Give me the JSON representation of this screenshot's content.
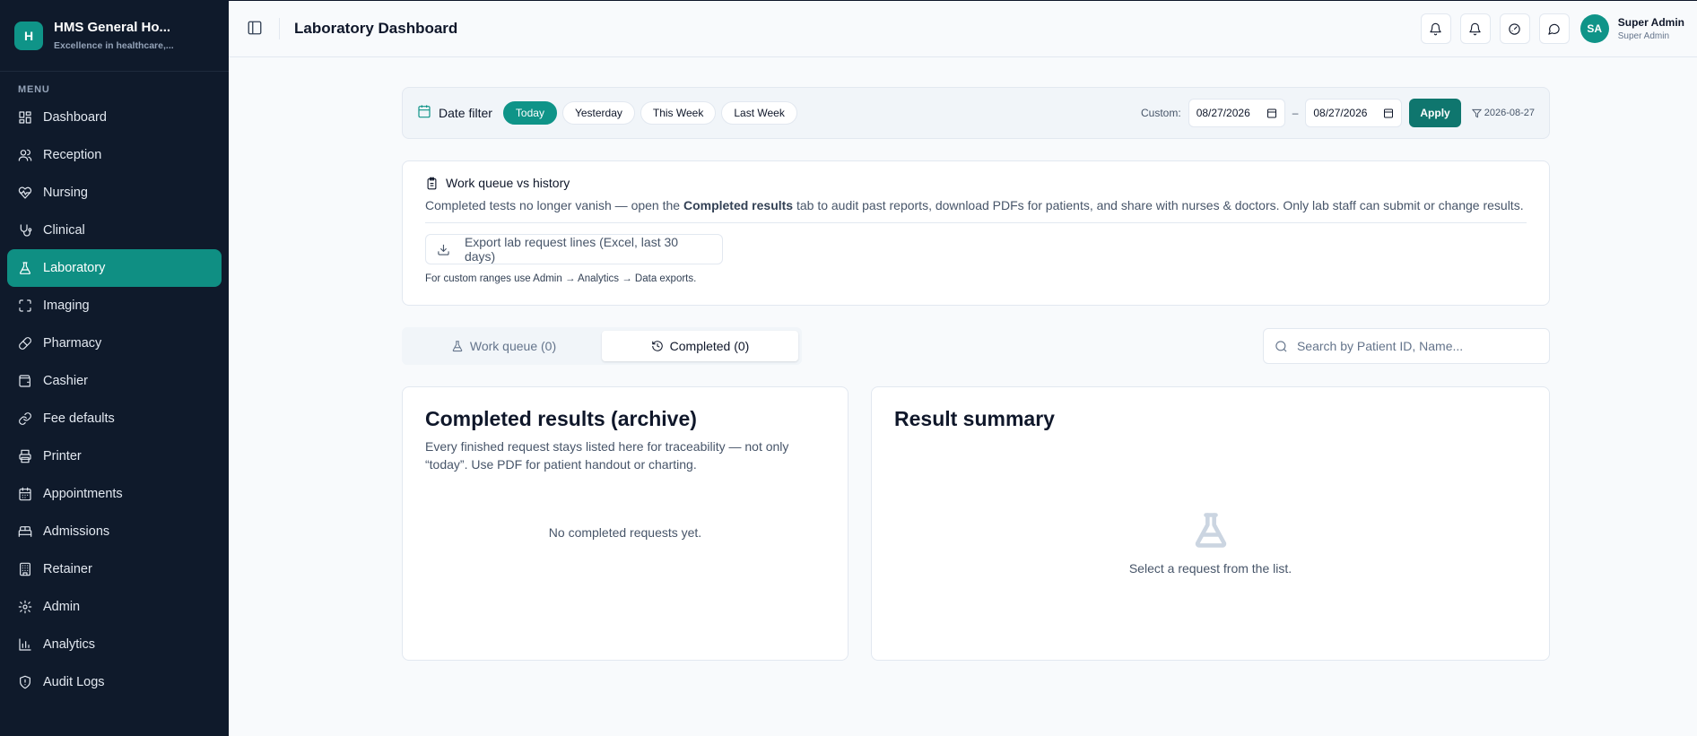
{
  "brand": {
    "logo_letter": "H",
    "title": "HMS General Ho...",
    "subtitle": "Excellence in healthcare,..."
  },
  "sidebar": {
    "menu_label": "MENU",
    "items": [
      {
        "label": "Dashboard",
        "icon": "grid-icon"
      },
      {
        "label": "Reception",
        "icon": "users-icon"
      },
      {
        "label": "Nursing",
        "icon": "heart-pulse-icon"
      },
      {
        "label": "Clinical",
        "icon": "stethoscope-icon"
      },
      {
        "label": "Laboratory",
        "icon": "flask-icon",
        "active": true
      },
      {
        "label": "Imaging",
        "icon": "scan-icon"
      },
      {
        "label": "Pharmacy",
        "icon": "pill-icon"
      },
      {
        "label": "Cashier",
        "icon": "wallet-icon"
      },
      {
        "label": "Fee defaults",
        "icon": "link-icon"
      },
      {
        "label": "Printer",
        "icon": "printer-icon"
      },
      {
        "label": "Appointments",
        "icon": "calendar-icon"
      },
      {
        "label": "Admissions",
        "icon": "bed-icon"
      },
      {
        "label": "Retainer",
        "icon": "building-icon"
      },
      {
        "label": "Admin",
        "icon": "gear-icon"
      },
      {
        "label": "Analytics",
        "icon": "bar-chart-icon"
      },
      {
        "label": "Audit Logs",
        "icon": "shield-icon"
      }
    ]
  },
  "header": {
    "title": "Laboratory Dashboard",
    "user": {
      "initials": "SA",
      "name": "Super Admin",
      "role": "Super Admin"
    }
  },
  "filter": {
    "label": "Date filter",
    "chips": [
      "Today",
      "Yesterday",
      "This Week",
      "Last Week"
    ],
    "active_chip": "Today",
    "custom_label": "Custom:",
    "date_from": "08/27/2026",
    "date_to": "08/27/2026",
    "separator": "–",
    "apply_label": "Apply",
    "applied_date": "2026-08-27"
  },
  "info": {
    "heading": "Work queue vs history",
    "text_before": "Completed tests no longer vanish — open the ",
    "text_bold": "Completed results",
    "text_after": " tab to audit past reports, download PDFs for patients, and share with nurses & doctors. Only lab staff can submit or change results.",
    "export_label": "Export lab request lines (Excel, last 30 days)",
    "note": "For custom ranges use Admin → Analytics → Data exports."
  },
  "tabs": {
    "work_queue": "Work queue (0)",
    "completed": "Completed (0)",
    "active": "completed"
  },
  "search": {
    "placeholder": "Search by Patient ID, Name..."
  },
  "left_panel": {
    "title": "Completed results (archive)",
    "description": "Every finished request stays listed here for traceability — not only “today”. Use PDF for patient handout or charting.",
    "empty": "No completed requests yet."
  },
  "right_panel": {
    "title": "Result summary",
    "empty": "Select a request from the list."
  },
  "colors": {
    "sidebar_bg": "#0f1a2b",
    "accent": "#0f9488",
    "apply": "#0f766e"
  }
}
